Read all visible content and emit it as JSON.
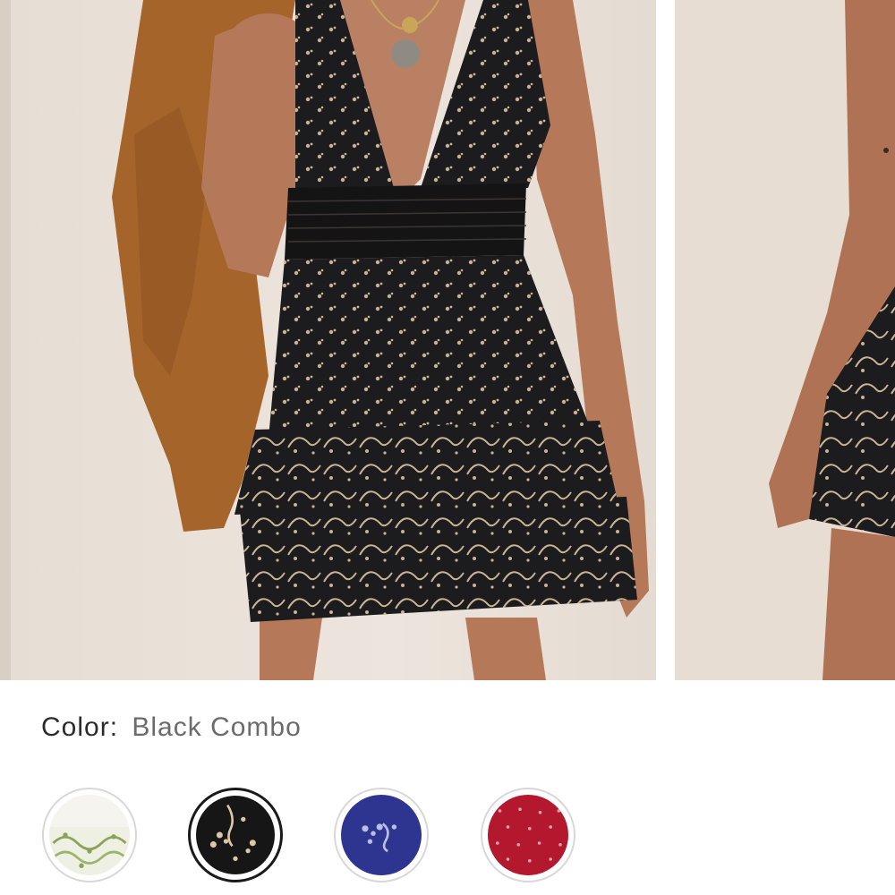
{
  "color_selector": {
    "label": "Color:",
    "selected_value": "Black Combo"
  },
  "gallery": {
    "images": [
      {
        "name": "product-image-main",
        "palette": {
          "wall": "#e9e0d8",
          "dress": "#1c1b1d",
          "print": "#c9b393",
          "jacket": "#a5642a",
          "skin": "#b5795a"
        }
      },
      {
        "name": "product-image-secondary",
        "palette": {
          "wall": "#e8ddd3",
          "dress": "#1c1b1d",
          "print": "#c9b393",
          "skin": "#b07254"
        }
      }
    ]
  },
  "swatches": [
    {
      "name": "swatch-ivory",
      "base": "#eef0e4",
      "pattern": "#8aa25a",
      "selected": false
    },
    {
      "name": "swatch-black-combo",
      "base": "#171617",
      "pattern": "#d9c7a7",
      "selected": true
    },
    {
      "name": "swatch-blue",
      "base": "#2d3590",
      "pattern": "#b9bfe4",
      "selected": false
    },
    {
      "name": "swatch-red",
      "base": "#b3182f",
      "pattern": "#e7a2a9",
      "selected": false
    }
  ]
}
